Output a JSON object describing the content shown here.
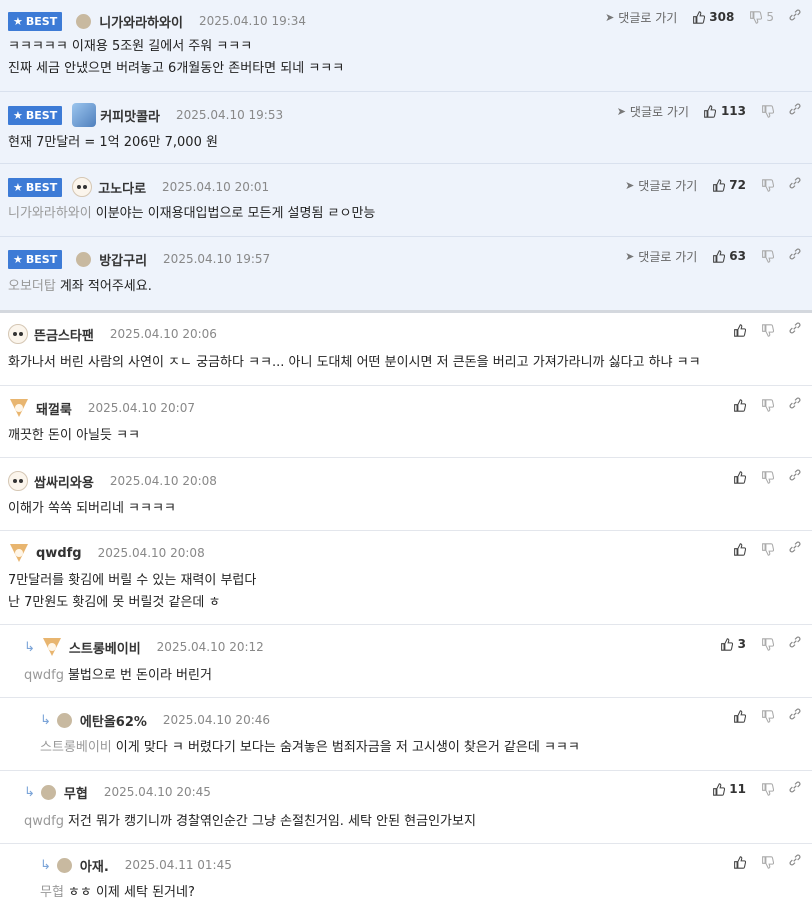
{
  "ui": {
    "best_label": "BEST",
    "goto_label": "댓글로 가기"
  },
  "comments": [
    {
      "best": true,
      "nick": "니가와라하와이",
      "date": "2025.04.10 19:34",
      "up": "308",
      "down": "5",
      "mention": "",
      "lines": [
        "ㅋㅋㅋㅋㅋ 이재용 5조원 길에서 주워 ㅋㅋㅋ",
        "진짜 세금 안냈으면 버려놓고 6개월동안 존버타면 되네 ㅋㅋㅋ"
      ]
    },
    {
      "best": true,
      "nick": "커피맛콜라",
      "date": "2025.04.10 19:53",
      "up": "113",
      "down": "",
      "mention": "",
      "lines": [
        "현재 7만달러 = 1억 206만 7,000 원"
      ]
    },
    {
      "best": true,
      "nick": "고노다로",
      "date": "2025.04.10 20:01",
      "up": "72",
      "down": "",
      "mention": "니가와라하와이",
      "lines": [
        "이분야는 이재용대입법으로 모든게 설명됨 ㄹㅇ만능"
      ]
    },
    {
      "best": true,
      "nick": "방갑구리",
      "date": "2025.04.10 19:57",
      "up": "63",
      "down": "",
      "mention": "오보더탑",
      "lines": [
        "계좌 적어주세요."
      ]
    },
    {
      "best": false,
      "nick": "뜬금스타팬",
      "date": "2025.04.10 20:06",
      "up": "",
      "down": "",
      "mention": "",
      "lines": [
        "화가나서 버린 사람의 사연이 ㅈㄴ 궁금하다 ㅋㅋ... 아니 도대체 어떤 분이시면 저 큰돈을 버리고 가져가라니까 싫다고 하냐 ㅋㅋ"
      ]
    },
    {
      "best": false,
      "nick": "돼껄룩",
      "date": "2025.04.10 20:07",
      "up": "",
      "down": "",
      "mention": "",
      "lines": [
        "깨끗한 돈이 아닐듯 ㅋㅋ"
      ]
    },
    {
      "best": false,
      "nick": "쌉싸리와용",
      "date": "2025.04.10 20:08",
      "up": "",
      "down": "",
      "mention": "",
      "lines": [
        "이해가 쏙쏙 되버리네 ㅋㅋㅋㅋ"
      ]
    },
    {
      "best": false,
      "nick": "qwdfg",
      "date": "2025.04.10 20:08",
      "up": "",
      "down": "",
      "mention": "",
      "lines": [
        "7만달러를 홧김에 버릴 수 있는 재력이 부럽다",
        "난 7만원도 홧김에 못 버릴것 같은데 ㅎ"
      ]
    },
    {
      "best": false,
      "nick": "스트롱베이비",
      "date": "2025.04.10 20:12",
      "up": "3",
      "down": "",
      "mention": "qwdfg",
      "lines": [
        "불법으로 번 돈이라 버린거"
      ]
    },
    {
      "best": false,
      "nick": "에탄올62%",
      "date": "2025.04.10 20:46",
      "up": "",
      "down": "",
      "mention": "스트롱베이비",
      "lines": [
        "이게 맞다 ㅋ 버렸다기 보다는 숨겨놓은 범죄자금을 저 고시생이 찾은거 같은데 ㅋㅋㅋ"
      ]
    },
    {
      "best": false,
      "nick": "무협",
      "date": "2025.04.10 20:45",
      "up": "11",
      "down": "",
      "mention": "qwdfg",
      "lines": [
        "저건 뭐가 캥기니까 경찰엮인순간 그냥 손절친거임. 세탁 안된 현금인가보지"
      ]
    },
    {
      "best": false,
      "nick": "아재.",
      "date": "2025.04.11 01:45",
      "up": "",
      "down": "",
      "mention": "무협",
      "lines": [
        "ㅎㅎ 이제 세탁 된거네?"
      ]
    }
  ]
}
